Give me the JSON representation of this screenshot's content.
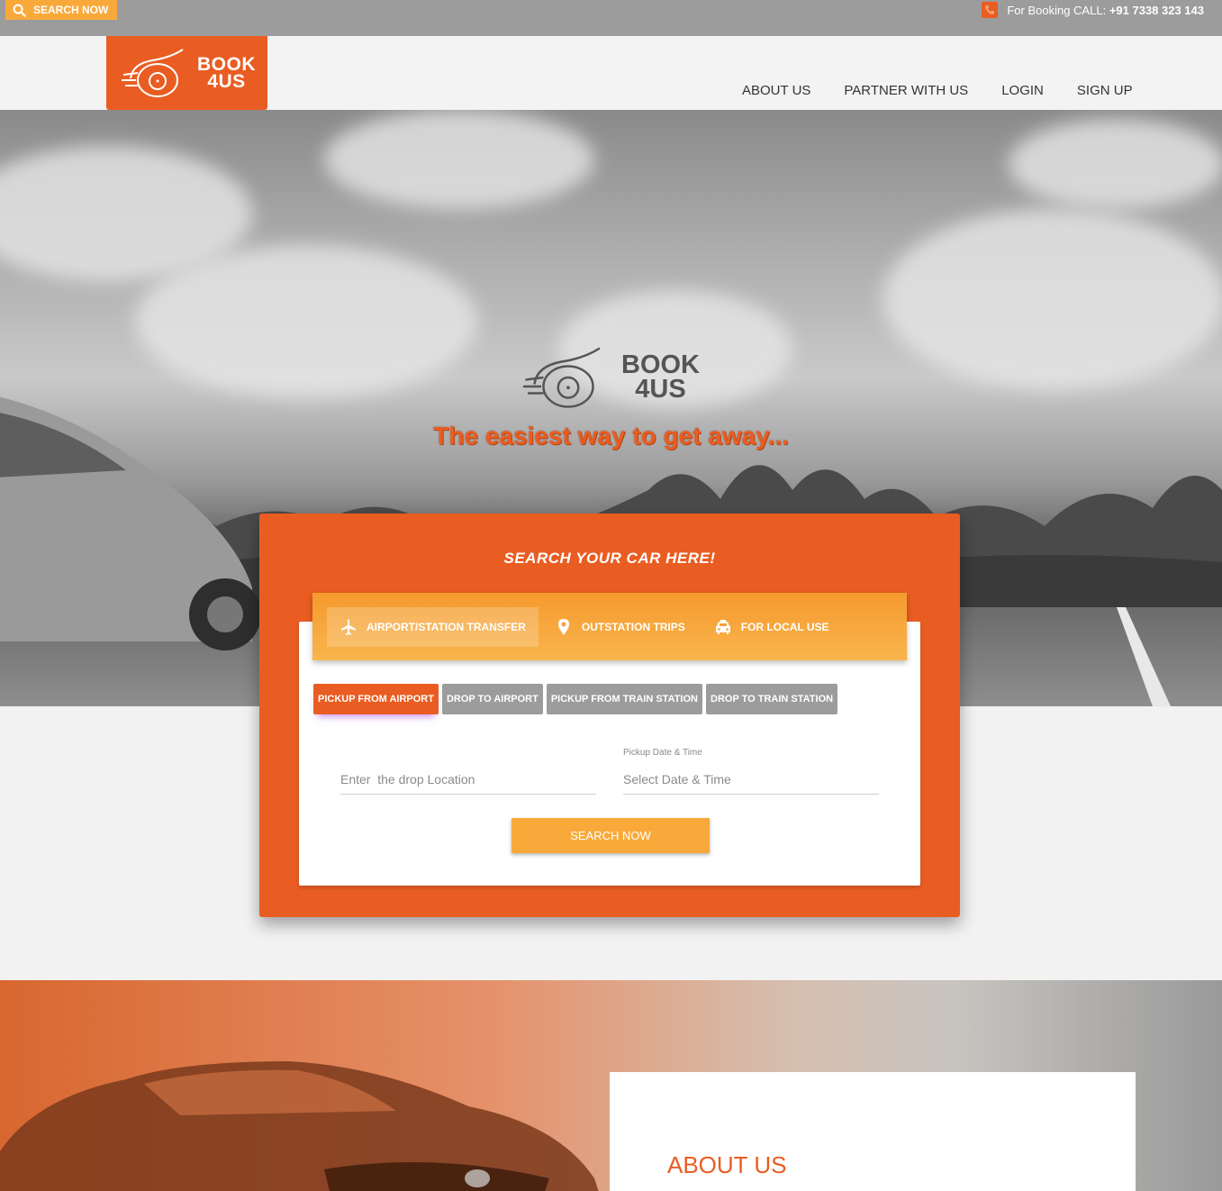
{
  "topbar": {
    "search_label": "SEARCH NOW",
    "booking_prefix": "For Booking CALL:",
    "booking_phone": "+91 7338 323 143"
  },
  "logo": {
    "line1": "BOOK",
    "line2": "4US"
  },
  "nav": {
    "items": [
      {
        "label": "ABOUT US"
      },
      {
        "label": "PARTNER WITH US"
      },
      {
        "label": "LOGIN"
      },
      {
        "label": "SIGN UP"
      }
    ]
  },
  "hero": {
    "logo_line1": "BOOK",
    "logo_line2": "4US",
    "tagline": "The easiest way to get away..."
  },
  "search": {
    "title": "SEARCH YOUR CAR HERE!",
    "tabs": [
      {
        "label": "AIRPORT/STATION TRANSFER",
        "icon": "airplane-icon",
        "active": true
      },
      {
        "label": "OUTSTATION TRIPS",
        "icon": "location-pin-icon",
        "active": false
      },
      {
        "label": "FOR LOCAL USE",
        "icon": "taxi-icon",
        "active": false
      }
    ],
    "subtabs": [
      {
        "label": "PICKUP FROM AIRPORT",
        "active": true
      },
      {
        "label": "DROP TO AIRPORT",
        "active": false
      },
      {
        "label": "PICKUP FROM TRAIN STATION",
        "active": false
      },
      {
        "label": "DROP TO TRAIN STATION",
        "active": false
      }
    ],
    "drop_location": {
      "label": "",
      "placeholder": "Enter  the drop Location",
      "value": ""
    },
    "pickup_datetime": {
      "label": "Pickup Date & Time",
      "placeholder": "Select Date & Time",
      "value": ""
    },
    "button_label": "SEARCH NOW"
  },
  "about": {
    "title": "ABOUT US"
  },
  "colors": {
    "brand_orange": "#e95d22",
    "accent_yellow": "#f9a93a",
    "topbar_gray": "#9c9c9c",
    "inactive_tab_gray": "#9c9c9c"
  }
}
